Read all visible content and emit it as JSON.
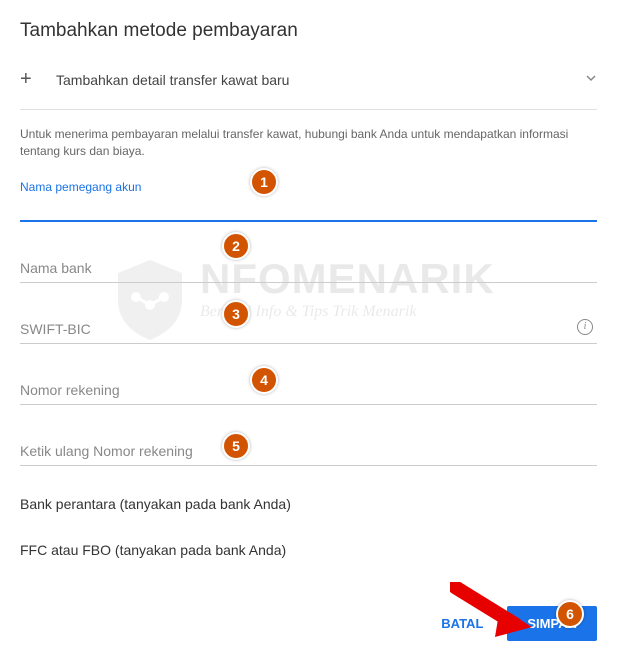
{
  "title": "Tambahkan metode pembayaran",
  "addRow": {
    "label": "Tambahkan detail transfer kawat baru"
  },
  "infoText": "Untuk menerima pembayaran melalui transfer kawat, hubungi bank Anda untuk mendapatkan informasi tentang kurs dan biaya.",
  "fields": {
    "accountHolder": {
      "label": "Nama pemegang akun",
      "value": ""
    },
    "bankName": {
      "placeholder": "Nama bank"
    },
    "swift": {
      "placeholder": "SWIFT-BIC"
    },
    "accountNumber": {
      "placeholder": "Nomor rekening"
    },
    "reAccountNumber": {
      "placeholder": "Ketik ulang Nomor rekening"
    }
  },
  "sections": {
    "intermediary": "Bank perantara (tanyakan pada bank Anda)",
    "ffc": "FFC atau FBO (tanyakan pada bank Anda)"
  },
  "buttons": {
    "cancel": "BATAL",
    "save": "SIMPAN"
  },
  "badges": {
    "b1": "1",
    "b2": "2",
    "b3": "3",
    "b4": "4",
    "b5": "5",
    "b6": "6"
  },
  "watermark": {
    "title": "NFOMENARIK",
    "sub": "Berbagi Info & Tips Trik Menarik"
  }
}
